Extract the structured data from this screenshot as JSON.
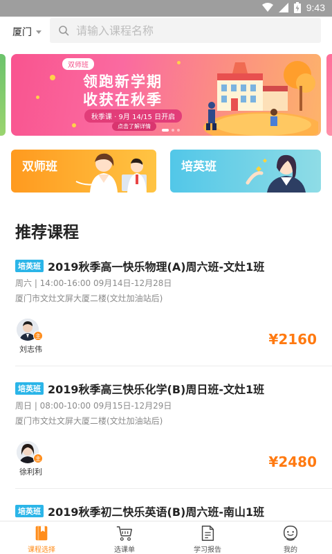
{
  "status_bar": {
    "time": "9:43"
  },
  "header": {
    "city": "厦门",
    "search_placeholder": "请输入课程名称"
  },
  "banner": {
    "tag": "双师班",
    "title_line1": "领跑新学期",
    "title_line2": "收获在秋季",
    "date_text": "秋季课 · 9月 14/15 日开启",
    "cta": "点击了解详情"
  },
  "categories": [
    {
      "label": "双师班",
      "color": "#ff9a1f"
    },
    {
      "label": "培英班",
      "color": "#52c7e8"
    }
  ],
  "recommended": {
    "title": "推荐课程",
    "courses": [
      {
        "badge": "培英班",
        "name": "2019秋季高一快乐物理(A)周六班-文灶1班",
        "schedule": "周六 | 14:00-16:00 09月14日-12月28日",
        "location": "厦门市文灶文屏大厦二楼(文灶加油站后)",
        "teacher_mark": "主",
        "teacher": "刘志伟",
        "price": "¥2160"
      },
      {
        "badge": "培英班",
        "name": "2019秋季高三快乐化学(B)周日班-文灶1班",
        "schedule": "周日 | 08:00-10:00 09月15日-12月29日",
        "location": "厦门市文灶文屏大厦二楼(文灶加油站后)",
        "teacher_mark": "主",
        "teacher": "徐利利",
        "price": "¥2480"
      },
      {
        "badge": "培英班",
        "name": "2019秋季初二快乐英语(B)周六班-南山1班"
      }
    ]
  },
  "tabs": [
    {
      "label": "课程选择",
      "icon": "book-icon",
      "active": true
    },
    {
      "label": "选课单",
      "icon": "cart-icon",
      "active": false
    },
    {
      "label": "学习报告",
      "icon": "report-icon",
      "active": false
    },
    {
      "label": "我的",
      "icon": "profile-icon",
      "active": false
    }
  ],
  "colors": {
    "accent": "#ff8c1a",
    "badge": "#2bb5e8",
    "price": "#ff7a11"
  }
}
